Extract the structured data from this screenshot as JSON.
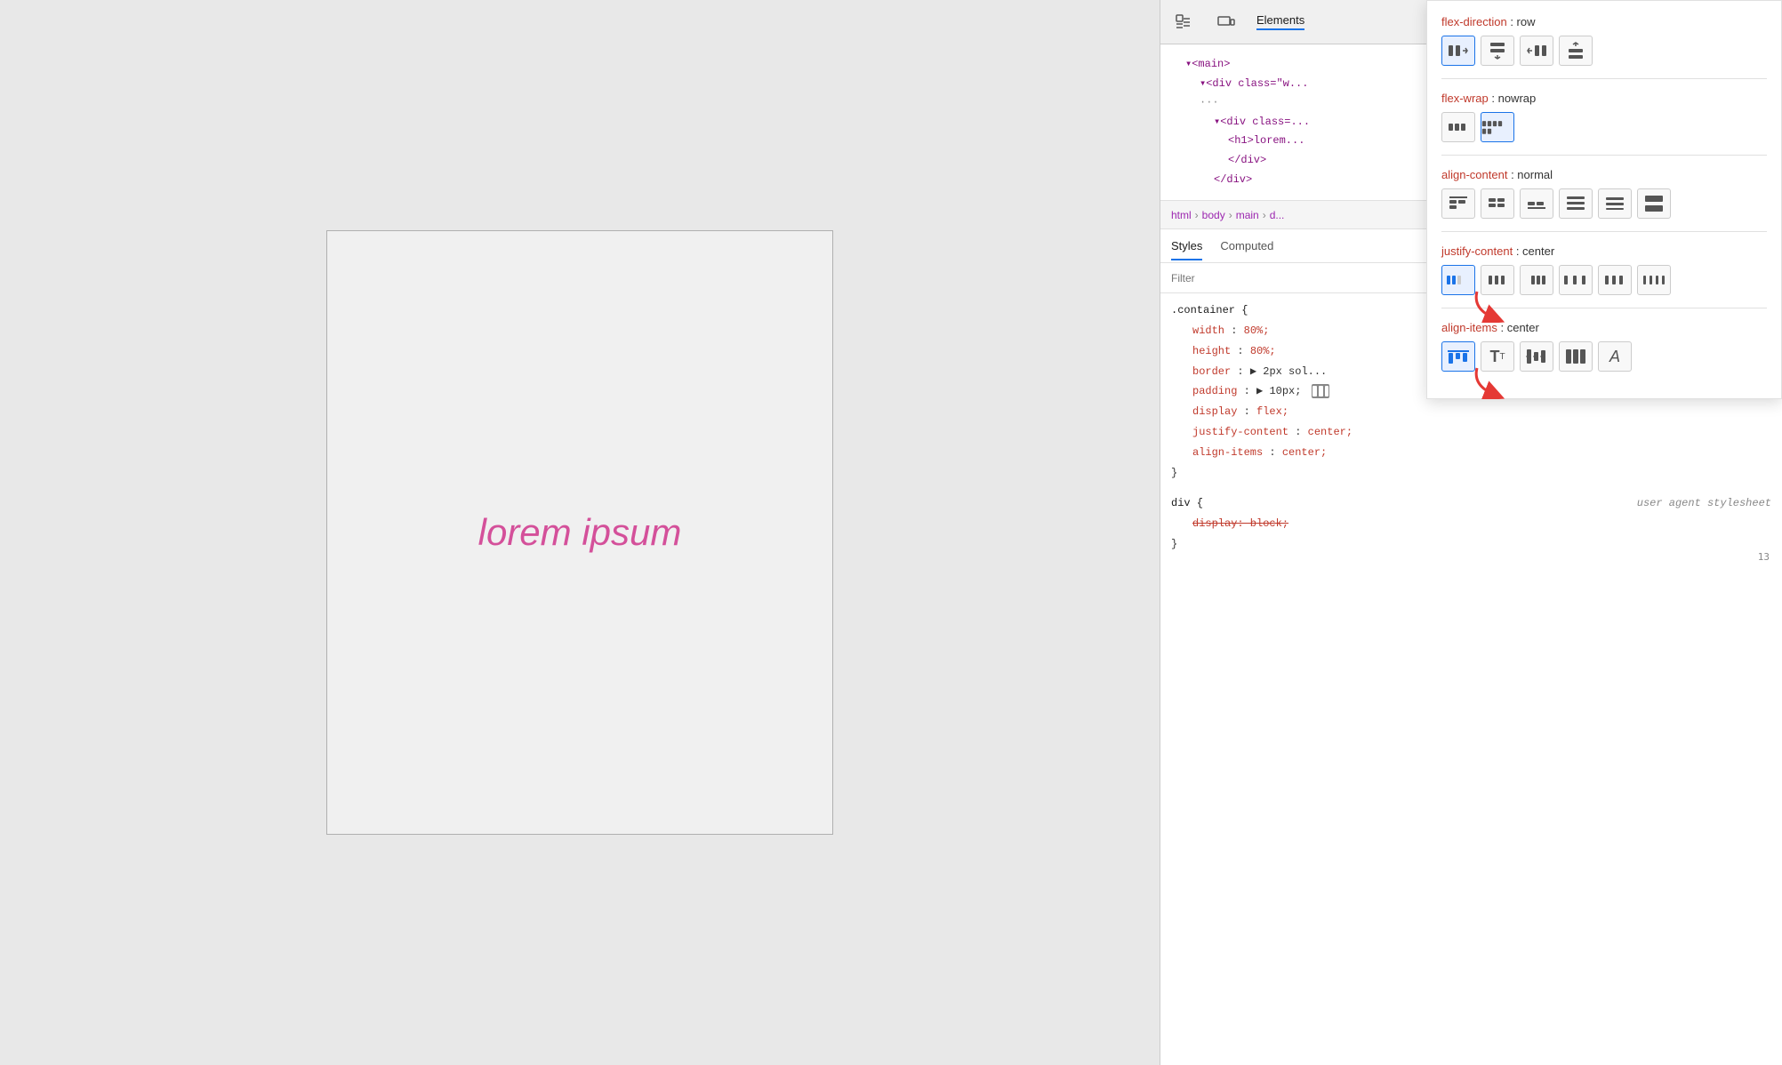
{
  "preview": {
    "lorem_text": "lorem ipsum"
  },
  "devtools": {
    "header": {
      "inspect_icon": "⬚",
      "device_icon": "▭",
      "tab_label": "Elements"
    },
    "elements": {
      "lines": [
        {
          "indent": 1,
          "text": "▾<main>"
        },
        {
          "indent": 2,
          "text": "▾<div class=\"w..."
        },
        {
          "indent": 0,
          "text": "···"
        },
        {
          "indent": 3,
          "text": "▾<div class=..."
        },
        {
          "indent": 4,
          "text": "<h1>lorem..."
        },
        {
          "indent": 4,
          "text": "</div>"
        },
        {
          "indent": 3,
          "text": "</div>"
        }
      ]
    },
    "breadcrumb": {
      "items": [
        "html",
        "body",
        "main",
        "d..."
      ]
    },
    "styles_tab": {
      "label": "Styles",
      "computed_label": "Computed"
    },
    "filter": {
      "placeholder": "Filter"
    },
    "css_rules": {
      "selector1": ".container {",
      "props": [
        {
          "name": "width",
          "value": "80%;"
        },
        {
          "name": "height",
          "value": "80%;"
        },
        {
          "name": "border",
          "value": "▶ 2px sol..."
        },
        {
          "name": "padding",
          "value": "▶ 10px;"
        },
        {
          "name": "display",
          "value": "flex;"
        },
        {
          "name": "justify-content",
          "value": "center;"
        },
        {
          "name": "align-items",
          "value": "center;"
        }
      ],
      "selector2": "div {",
      "user_agent": "user agent stylesheet",
      "strikethrough_prop": "display: block;",
      "close_brace": "}"
    }
  },
  "flex_popup": {
    "props": [
      {
        "key": "flex-direction",
        "value": "row",
        "icons": [
          {
            "symbol": "⇒",
            "label": "row",
            "active": true
          },
          {
            "symbol": "⇓",
            "label": "column",
            "active": false
          },
          {
            "symbol": "⇐",
            "label": "row-reverse",
            "active": false
          },
          {
            "symbol": "⇑",
            "label": "column-reverse",
            "active": false
          }
        ]
      },
      {
        "key": "flex-wrap",
        "value": "nowrap",
        "icons": [
          {
            "symbol": "≡",
            "label": "nowrap",
            "active": false
          },
          {
            "symbol": "⊞",
            "label": "wrap",
            "active": true
          }
        ]
      },
      {
        "key": "align-content",
        "value": "normal",
        "icons": [
          {
            "symbol": "⊟",
            "label": "start",
            "active": false
          },
          {
            "symbol": "⊠",
            "label": "center",
            "active": false
          },
          {
            "symbol": "⊡",
            "label": "end",
            "active": false
          },
          {
            "symbol": "⊞",
            "label": "space-between",
            "active": false
          },
          {
            "symbol": "⊟",
            "label": "space-around",
            "active": false
          },
          {
            "symbol": "⊠",
            "label": "stretch",
            "active": false
          }
        ]
      },
      {
        "key": "justify-content",
        "value": "center",
        "icons": [
          {
            "symbol": "⬛",
            "label": "start",
            "active": true
          },
          {
            "symbol": "⬜",
            "label": "center",
            "active": false
          },
          {
            "symbol": "⬜",
            "label": "end",
            "active": false
          },
          {
            "symbol": "⬜",
            "label": "space-between",
            "active": false
          },
          {
            "symbol": "⬜",
            "label": "space-around",
            "active": false
          },
          {
            "symbol": "⬜",
            "label": "space-evenly",
            "active": false
          }
        ]
      },
      {
        "key": "align-items",
        "value": "center",
        "icons": [
          {
            "symbol": "⬛",
            "label": "start",
            "active": true
          },
          {
            "symbol": "T",
            "label": "baseline",
            "active": false
          },
          {
            "symbol": "≡",
            "label": "center",
            "active": false
          },
          {
            "symbol": "‖",
            "label": "stretch",
            "active": false
          },
          {
            "symbol": "A",
            "label": "end",
            "active": false
          }
        ]
      }
    ],
    "arrows": {
      "arrow1_label": "▼",
      "arrow2_label": "▼"
    }
  },
  "line_number": "13"
}
